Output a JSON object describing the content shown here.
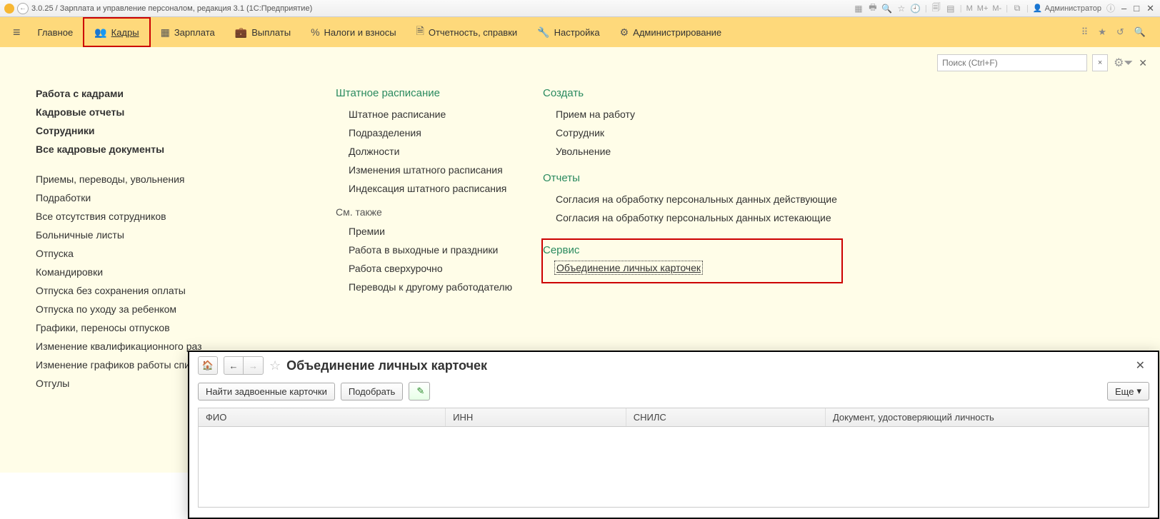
{
  "titlebar": {
    "title": "3.0.25 / Зарплата и управление персоналом, редакция 3.1  (1С:Предприятие)",
    "user": "Администратор",
    "m": "M",
    "mplus": "M+",
    "mminus": "M-"
  },
  "nav": {
    "items": [
      {
        "icon": "≡",
        "label": ""
      },
      {
        "icon": "",
        "label": "Главное"
      },
      {
        "icon": "👥",
        "label": "Кадры"
      },
      {
        "icon": "▦",
        "label": "Зарплата"
      },
      {
        "icon": "💼",
        "label": "Выплаты"
      },
      {
        "icon": "%",
        "label": "Налоги и взносы"
      },
      {
        "icon": "🗎",
        "label": "Отчетность, справки"
      },
      {
        "icon": "🔧",
        "label": "Настройка"
      },
      {
        "icon": "⚙",
        "label": "Администрирование"
      }
    ]
  },
  "search": {
    "placeholder": "Поиск (Ctrl+F)"
  },
  "col1": {
    "group1": [
      "Работа с кадрами",
      "Кадровые отчеты",
      "Сотрудники",
      "Все кадровые документы"
    ],
    "group2": [
      "Приемы, переводы, увольнения",
      "Подработки",
      "Все отсутствия сотрудников",
      "Больничные листы",
      "Отпуска",
      "Командировки",
      "Отпуска без сохранения оплаты",
      "Отпуска по уходу за ребенком",
      "Графики, переносы отпусков",
      "Изменение квалификационного раз",
      "Изменение графиков работы списк",
      "Отгулы"
    ]
  },
  "col2": {
    "title": "Штатное расписание",
    "items": [
      "Штатное расписание",
      "Подразделения",
      "Должности",
      "Изменения штатного расписания",
      "Индексация штатного расписания"
    ],
    "see_also_title": "См. также",
    "see_also": [
      "Премии",
      "Работа в выходные и праздники",
      "Работа сверхурочно",
      "Переводы к другому работодателю"
    ]
  },
  "col3": {
    "create_title": "Создать",
    "create": [
      "Прием на работу",
      "Сотрудник",
      "Увольнение"
    ],
    "reports_title": "Отчеты",
    "reports": [
      "Согласия на обработку персональных данных действующие",
      "Согласия на обработку персональных данных истекающие"
    ],
    "service_title": "Сервис",
    "service_link": "Объединение личных карточек"
  },
  "modal": {
    "title": "Объединение личных карточек",
    "btn_find": "Найти задвоенные карточки",
    "btn_pick": "Подобрать",
    "btn_more": "Еще",
    "columns": [
      "ФИО",
      "ИНН",
      "СНИЛС",
      "Документ, удостоверяющий личность"
    ]
  }
}
